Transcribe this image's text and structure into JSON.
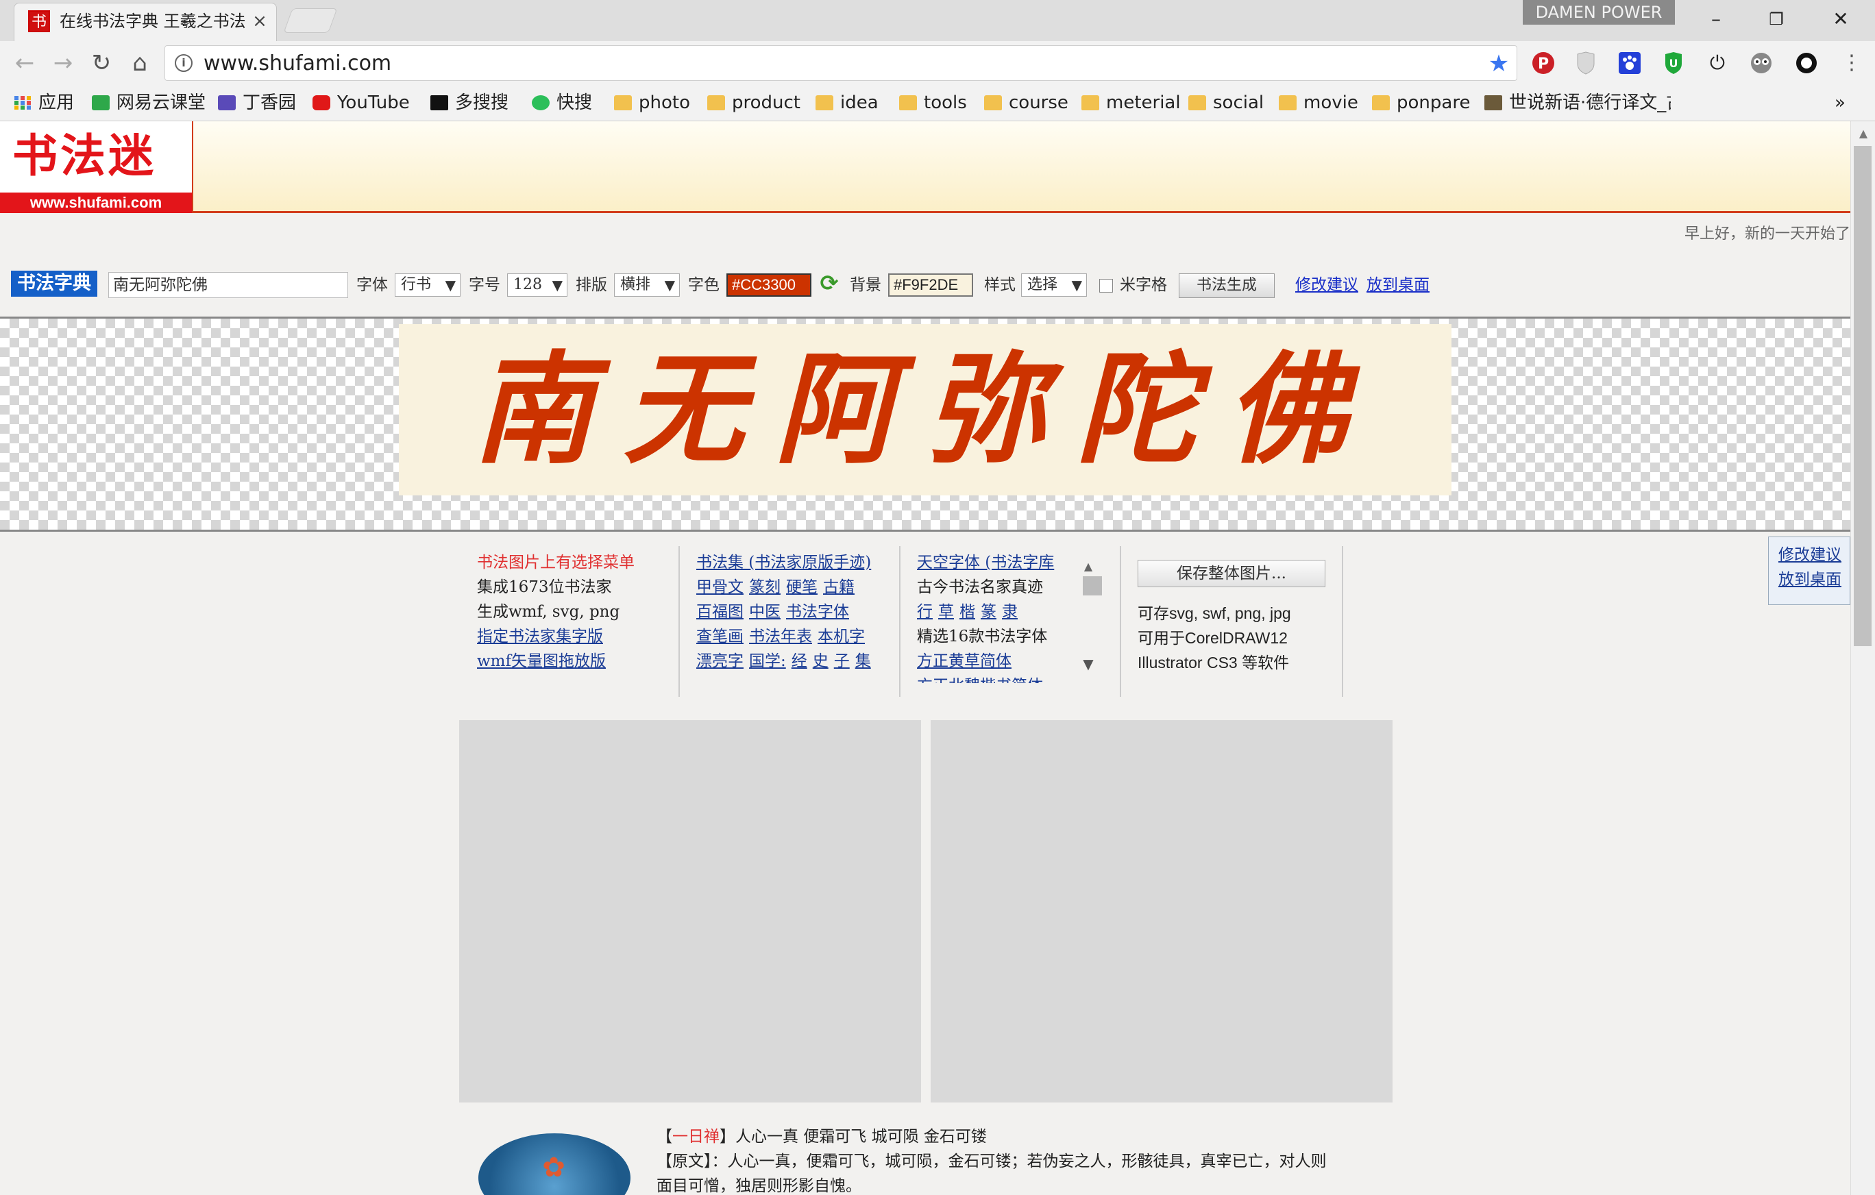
{
  "browser": {
    "tab_title": "在线书法字典 王羲之书法",
    "tab_favicon": "书",
    "tab_close": "×",
    "profile": "DAMEN POWER",
    "window_controls": {
      "minimize": "–",
      "restore": "❐",
      "close": "✕"
    },
    "nav": {
      "back": "←",
      "forward": "→",
      "reload": "↻",
      "home": "⌂"
    },
    "url": "www.shufami.com",
    "info_icon": "i",
    "star_icon": "★",
    "extensions": [
      "pinterest-icon",
      "shield-gray-icon",
      "paw-icon",
      "green-shield-icon",
      "power-icon",
      "owl-icon",
      "circle-icon",
      "menu-dots-icon"
    ],
    "bookmarks": [
      {
        "label": "应用",
        "icon": "apps-grid-icon"
      },
      {
        "label": "网易云课堂",
        "icon": "green-book-icon"
      },
      {
        "label": "丁香园",
        "icon": "clove-icon"
      },
      {
        "label": "YouTube",
        "icon": "youtube-icon"
      },
      {
        "label": "多搜搜",
        "icon": "dark-square-icon"
      },
      {
        "label": "快搜",
        "icon": "green-q-icon"
      },
      {
        "label": "photo",
        "icon": "folder-icon"
      },
      {
        "label": "product",
        "icon": "folder-icon"
      },
      {
        "label": "idea",
        "icon": "folder-icon"
      },
      {
        "label": "tools",
        "icon": "folder-icon"
      },
      {
        "label": "course",
        "icon": "folder-icon"
      },
      {
        "label": "meterial",
        "icon": "folder-icon"
      },
      {
        "label": "social",
        "icon": "folder-icon"
      },
      {
        "label": "movie",
        "icon": "folder-icon"
      },
      {
        "label": "ponpare",
        "icon": "folder-icon"
      },
      {
        "label": "世说新语·德行译文_古",
        "icon": "poem-icon"
      }
    ],
    "bookmarks_more": "»"
  },
  "site": {
    "logo_text": "书法迷",
    "logo_url": "www.shufami.com",
    "greeting": "早上好，新的一天开始了",
    "form": {
      "dict_label": "书法字典",
      "input_value": "南无阿弥陀佛",
      "font_label": "字体",
      "font_value": "行书",
      "size_label": "字号",
      "size_value": "128",
      "layout_label": "排版",
      "layout_value": "横排",
      "color_label": "字色",
      "color_value": "#CC3300",
      "bg_label": "背景",
      "bg_value": "#F9F2DE",
      "style_label": "样式",
      "style_value": "选择",
      "grid_label": "米字格",
      "generate_button": "书法生成",
      "suggest_link": "修改建议",
      "desktop_link": "放到桌面",
      "dropdown_arrow": "▼",
      "refresh_icon": "⟳"
    },
    "preview_text": "南无阿弥陀佛",
    "accent_colors": {
      "ink": "#CC3300",
      "paper": "#F9F2DE",
      "logo_red": "#E3151A",
      "label_blue": "#1560C8"
    },
    "info": {
      "col1": [
        "书法图片上有选择菜单",
        "集成1673位书法家",
        "生成wmf, svg, png",
        "指定书法家集字版",
        "wmf矢量图拖放版"
      ],
      "col2": {
        "row1": [
          "书法集 (书法家原版手迹)"
        ],
        "row2": [
          "甲骨文",
          "篆刻",
          "硬笔",
          "古籍"
        ],
        "row3": [
          "百福图",
          "中医",
          "书法字体"
        ],
        "row4": [
          "查笔画",
          "书法年表",
          "本机字"
        ],
        "row5": [
          "漂亮字",
          "国学:",
          "经",
          "史",
          "子",
          "集"
        ]
      },
      "col3": {
        "row1": "天空字体 (书法字库",
        "row2": "古今书法名家真迹",
        "row3": [
          "行",
          "草",
          "楷",
          "篆",
          "隶"
        ],
        "row4": "精选16款书法字体",
        "row5": "方正黄草简体",
        "row6": "方正北魏楷书简体"
      },
      "scroll_up": "▲",
      "scroll_down": "▼",
      "save_button": "保存整体图片...",
      "save_lines": [
        "可存svg, swf, png, jpg",
        "可用于CorelDRAW12",
        "Illustrator CS3 等软件"
      ]
    },
    "side_links": [
      "修改建议",
      "放到桌面"
    ],
    "footer": {
      "line1_prefix": "【",
      "line1_title": "一日禅",
      "line1_rest": "】人心一真 便霜可飞 城可陨 金石可镂",
      "line2": "【原文】：人心一真，便霜可飞，城可陨，金石可镂；若伪妄之人，形骸徒具，真宰已亡，对人则",
      "line3": "面目可憎，独居则形影自愧。"
    }
  }
}
